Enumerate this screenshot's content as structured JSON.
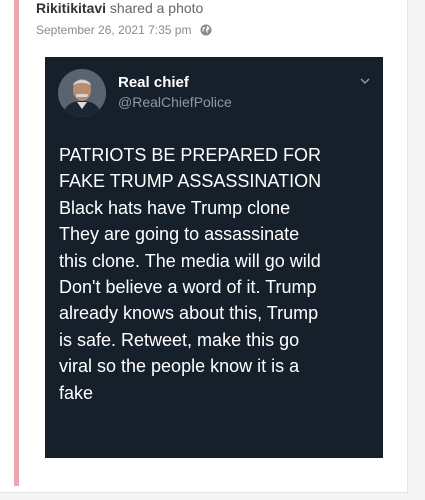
{
  "post": {
    "author": "Rikitikitavi",
    "action": "shared a photo",
    "timestamp": "September 26, 2021 7:35 pm",
    "privacy_icon": "globe-icon",
    "accent_color": "#eba7ad"
  },
  "tweet": {
    "display_name": "Real chief",
    "handle": "@RealChiefPolice",
    "avatar_icon": "avatar",
    "menu_icon": "chevron-down-icon",
    "background_color": "#15202b",
    "text": "PATRIOTS BE PREPARED FOR\nFAKE TRUMP ASSASSINATION\nBlack hats have Trump clone\nThey are going to assassinate\nthis clone. The media will go wild\nDon't believe a word of it. Trump\nalready knows about this, Trump\nis safe. Retweet, make this go\nviral so the people know it is a\nfake"
  }
}
